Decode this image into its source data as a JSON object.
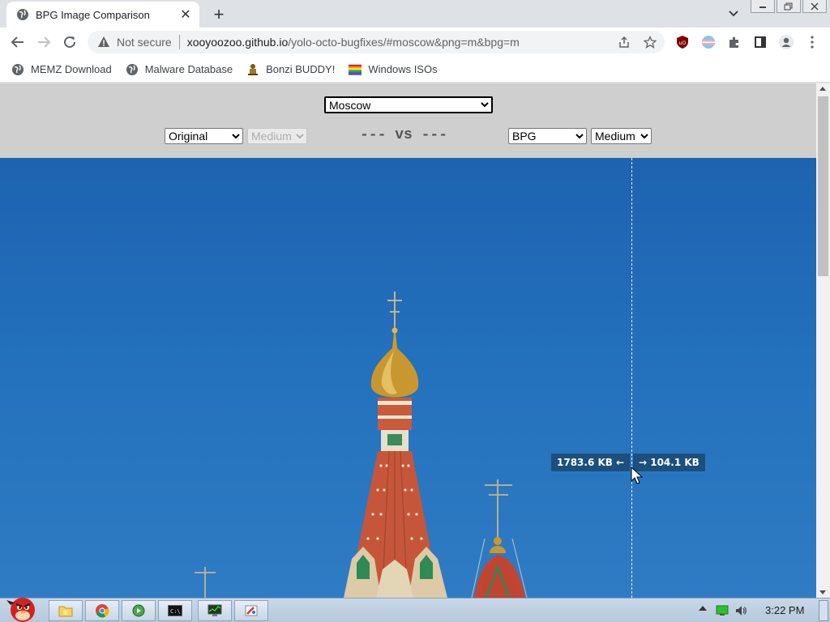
{
  "browser": {
    "tab": {
      "title": "BPG Image Comparison",
      "close_label": "✕"
    },
    "new_tab_label": "+",
    "omnibox": {
      "security_text": "Not secure",
      "url_host": "xooyoozoo.github.io",
      "url_path": "/yolo-octo-bugfixes/#moscow&png=m&bpg=m"
    },
    "bookmarks": [
      {
        "label": "MEMZ Download",
        "icon": "globe-icon"
      },
      {
        "label": "Malware Database",
        "icon": "globe-icon"
      },
      {
        "label": "Bonzi BUDDY!",
        "icon": "bonzi-icon"
      },
      {
        "label": "Windows ISOs",
        "icon": "windows-flag-icon"
      }
    ]
  },
  "page": {
    "image_select": {
      "selected": "Moscow"
    },
    "left": {
      "format": "Original",
      "quality": "Medium",
      "quality_disabled": true
    },
    "vs_text": "--- vs ---",
    "right": {
      "format": "BPG",
      "quality": "Medium"
    },
    "left_size": "1783.6 KB ←",
    "right_size": "→ 104.1 KB"
  },
  "taskbar": {
    "clock": "3:22 PM",
    "items": [
      "explorer",
      "chrome",
      "media-player",
      "command-prompt",
      "task-manager",
      "paint"
    ]
  },
  "colors": {
    "sky_top": "#1d63b0",
    "size_label_bg": "#1c4f7c",
    "controls_bg": "#cfcfcf"
  }
}
